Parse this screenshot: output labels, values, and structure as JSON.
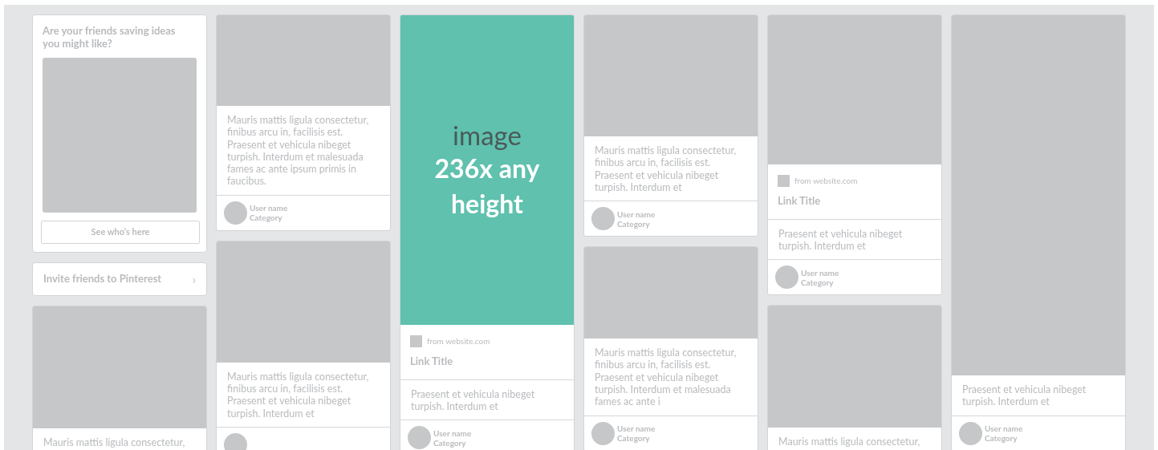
{
  "columns": [
    [
      {
        "kind": "prompt",
        "heading": "Are your friends saving ideas you might like?",
        "button": "See who’s here"
      },
      {
        "kind": "invite",
        "label": "Invite friends to Pinterest",
        "chevron": "›"
      },
      {
        "kind": "pin",
        "description": "Mauris mattis ligula consectetur,"
      }
    ],
    [
      {
        "kind": "pin",
        "description": "Mauris mattis ligula consectetur, finibus arcu in, facilisis est. Praesent et vehicula nibeget turpish. Interdum et malesuada fames ac ante ipsum primis in faucibus.",
        "user": "User name",
        "category": "Category"
      },
      {
        "kind": "pin",
        "description": "Mauris mattis ligula consectetur, finibus arcu in, facilisis est. Praesent et vehicula nibeget turpish. Interdum et",
        "avatar": true
      }
    ],
    [
      {
        "kind": "pin",
        "image": {
          "label": "image",
          "size": "236x any height"
        },
        "source": "from website.com",
        "link_title": "Link Title",
        "description": "Praesent et vehicula nibeget turpish. Interdum et",
        "user": "User name",
        "category": "Category"
      }
    ],
    [
      {
        "kind": "pin",
        "description": "Mauris mattis ligula consectetur, finibus arcu in, facilisis est. Praesent et vehicula nibeget turpish. Interdum et",
        "user": "User name",
        "category": "Category"
      },
      {
        "kind": "pin",
        "description": "Mauris mattis ligula consectetur, finibus arcu in, facilisis est. Praesent et vehicula nibeget turpish. Interdum et malesuada fames ac ante i",
        "user": "User name",
        "category": "Category"
      }
    ],
    [
      {
        "kind": "pin",
        "source": "from website.com",
        "link_title": "Link Title",
        "description": "Praesent et vehicula nibeget turpish. Interdum et",
        "user": "User name",
        "category": "Category"
      },
      {
        "kind": "pin",
        "description": "Mauris mattis ligula consectetur,"
      }
    ],
    [
      {
        "kind": "pin",
        "description": "Praesent et vehicula nibeget turpish. Interdum et",
        "user": "User name",
        "category": "Category"
      }
    ]
  ]
}
